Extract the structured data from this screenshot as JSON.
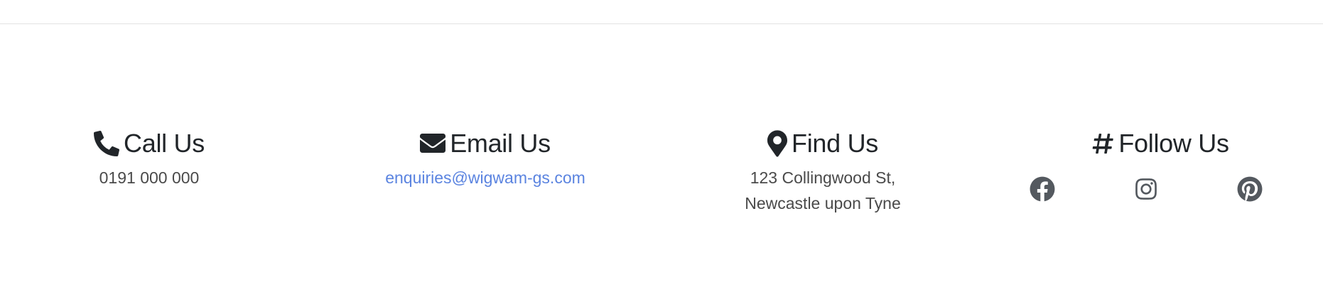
{
  "footer": {
    "call": {
      "title": "Call Us",
      "phone": "0191 000 000",
      "icon": "phone-icon"
    },
    "email": {
      "title": "Email Us",
      "address": "enquiries@wigwam-gs.com",
      "icon": "envelope-icon"
    },
    "find": {
      "title": "Find Us",
      "address_line_1": "123 Collingwood St,",
      "address_line_2": "Newcastle upon Tyne",
      "icon": "map-pin-icon"
    },
    "follow": {
      "title": "Follow Us",
      "icon": "hashtag-icon",
      "socials": [
        {
          "name": "facebook",
          "icon": "facebook-icon"
        },
        {
          "name": "instagram",
          "icon": "instagram-icon"
        },
        {
          "name": "pinterest",
          "icon": "pinterest-icon"
        }
      ]
    }
  },
  "colors": {
    "text": "#212529",
    "muted": "#4a4a4a",
    "link": "#5b84e0",
    "social": "#54595f",
    "divider": "#e3e3e3"
  }
}
